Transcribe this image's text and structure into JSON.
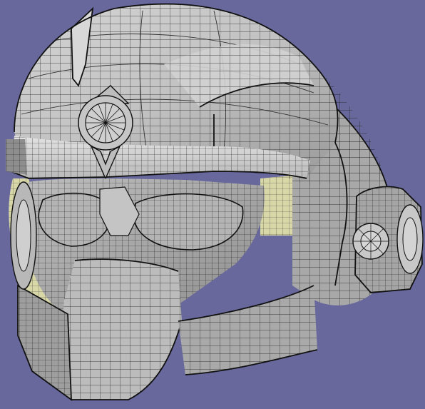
{
  "viewport": {
    "background_color": "#68689c",
    "subject": "helmet-wireframe-model"
  },
  "colors": {
    "shell_light": "#c9c9c9",
    "shell_mid": "#a9a9a9",
    "shell_dark": "#8a8a8a",
    "shell_highlight": "#e6e6e6",
    "interior_cream": "#d7d7a8",
    "interior_shadow": "#b8b88c",
    "wire": "#1a1a1a"
  }
}
